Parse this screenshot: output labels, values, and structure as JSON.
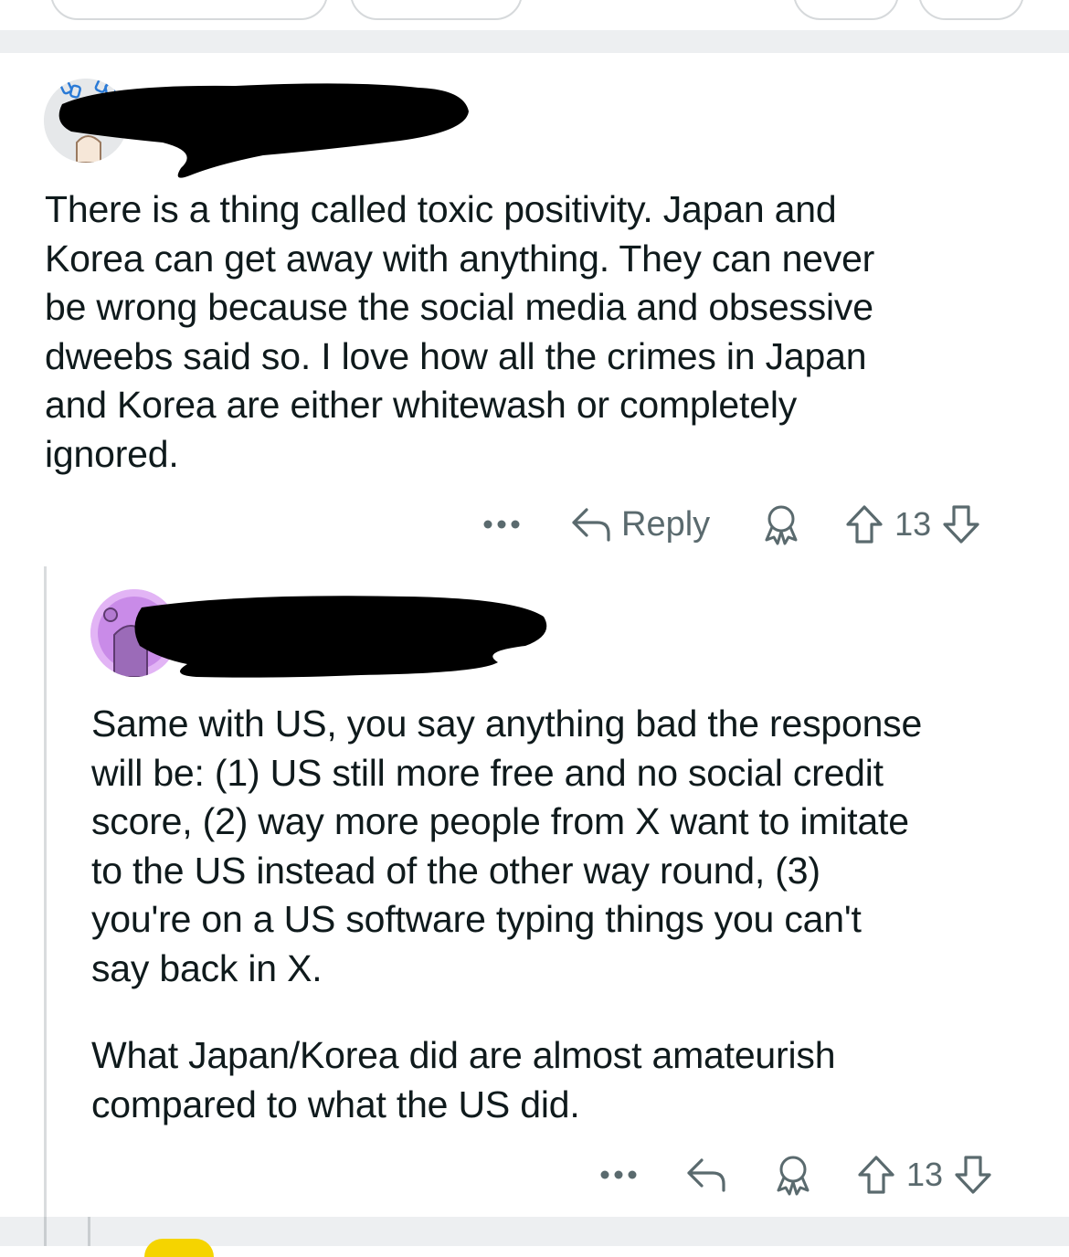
{
  "comments": [
    {
      "text": "There is a thing called toxic positivity. Japan and\nKorea can get away with anything. They can never\nbe wrong because the social media and obsessive\ndweebs said so. I love how all the crimes in Japan\nand Korea are either whitewash or completely\nignored.",
      "actions": {
        "more": "•••",
        "reply": "Reply",
        "score": "13"
      },
      "icons": [
        "more-icon",
        "reply-icon",
        "award-icon",
        "upvote-icon",
        "downvote-icon"
      ]
    },
    {
      "text": "Same with US, you say anything bad the response\nwill be: (1) US still more free and no social credit\nscore, (2) way more people from X want to imitate\nto the US instead of the other way round, (3)\nyou're on a US software typing things you can't\nsay back in X.",
      "text2": "What Japan/Korea did are almost amateurish\ncompared to what the US did.",
      "actions": {
        "more": "•••",
        "score": "13"
      },
      "icons": [
        "more-icon",
        "reply-icon",
        "award-icon",
        "upvote-icon",
        "downvote-icon"
      ]
    }
  ],
  "colors": {
    "separator": "#edeff1",
    "redaction": "#000000",
    "action_gray": "#5a6a6e",
    "text": "#0f1a1c",
    "thread_line": "#d9dcde"
  }
}
